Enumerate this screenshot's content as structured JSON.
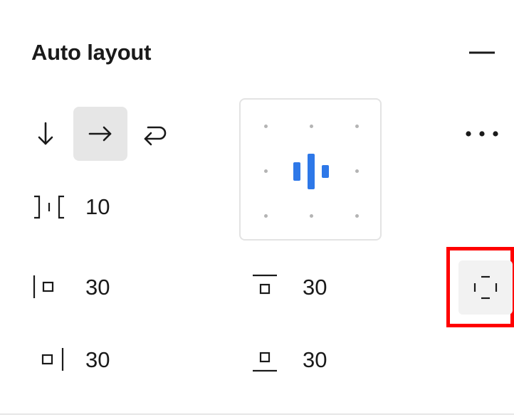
{
  "panel": {
    "title": "Auto layout",
    "collapse_icon": "minus-icon"
  },
  "direction": {
    "options": [
      {
        "icon": "arrow-down-icon",
        "label": "Vertical"
      },
      {
        "icon": "arrow-right-icon",
        "label": "Horizontal",
        "selected": true
      },
      {
        "icon": "wrap-icon",
        "label": "Wrap"
      }
    ]
  },
  "alignment": {
    "icon": "align-center-icon",
    "accent_color": "#2e78e8",
    "dot_color": "#b4b4b4"
  },
  "more": {
    "icon": "more-horizontal-icon"
  },
  "spacing": {
    "gap_value": "10",
    "padding_left": "30",
    "padding_top": "30",
    "padding_right": "30",
    "padding_bottom": "30"
  },
  "clip_content": {
    "icon": "clip-content-icon",
    "highlight_color": "#ff0000"
  }
}
